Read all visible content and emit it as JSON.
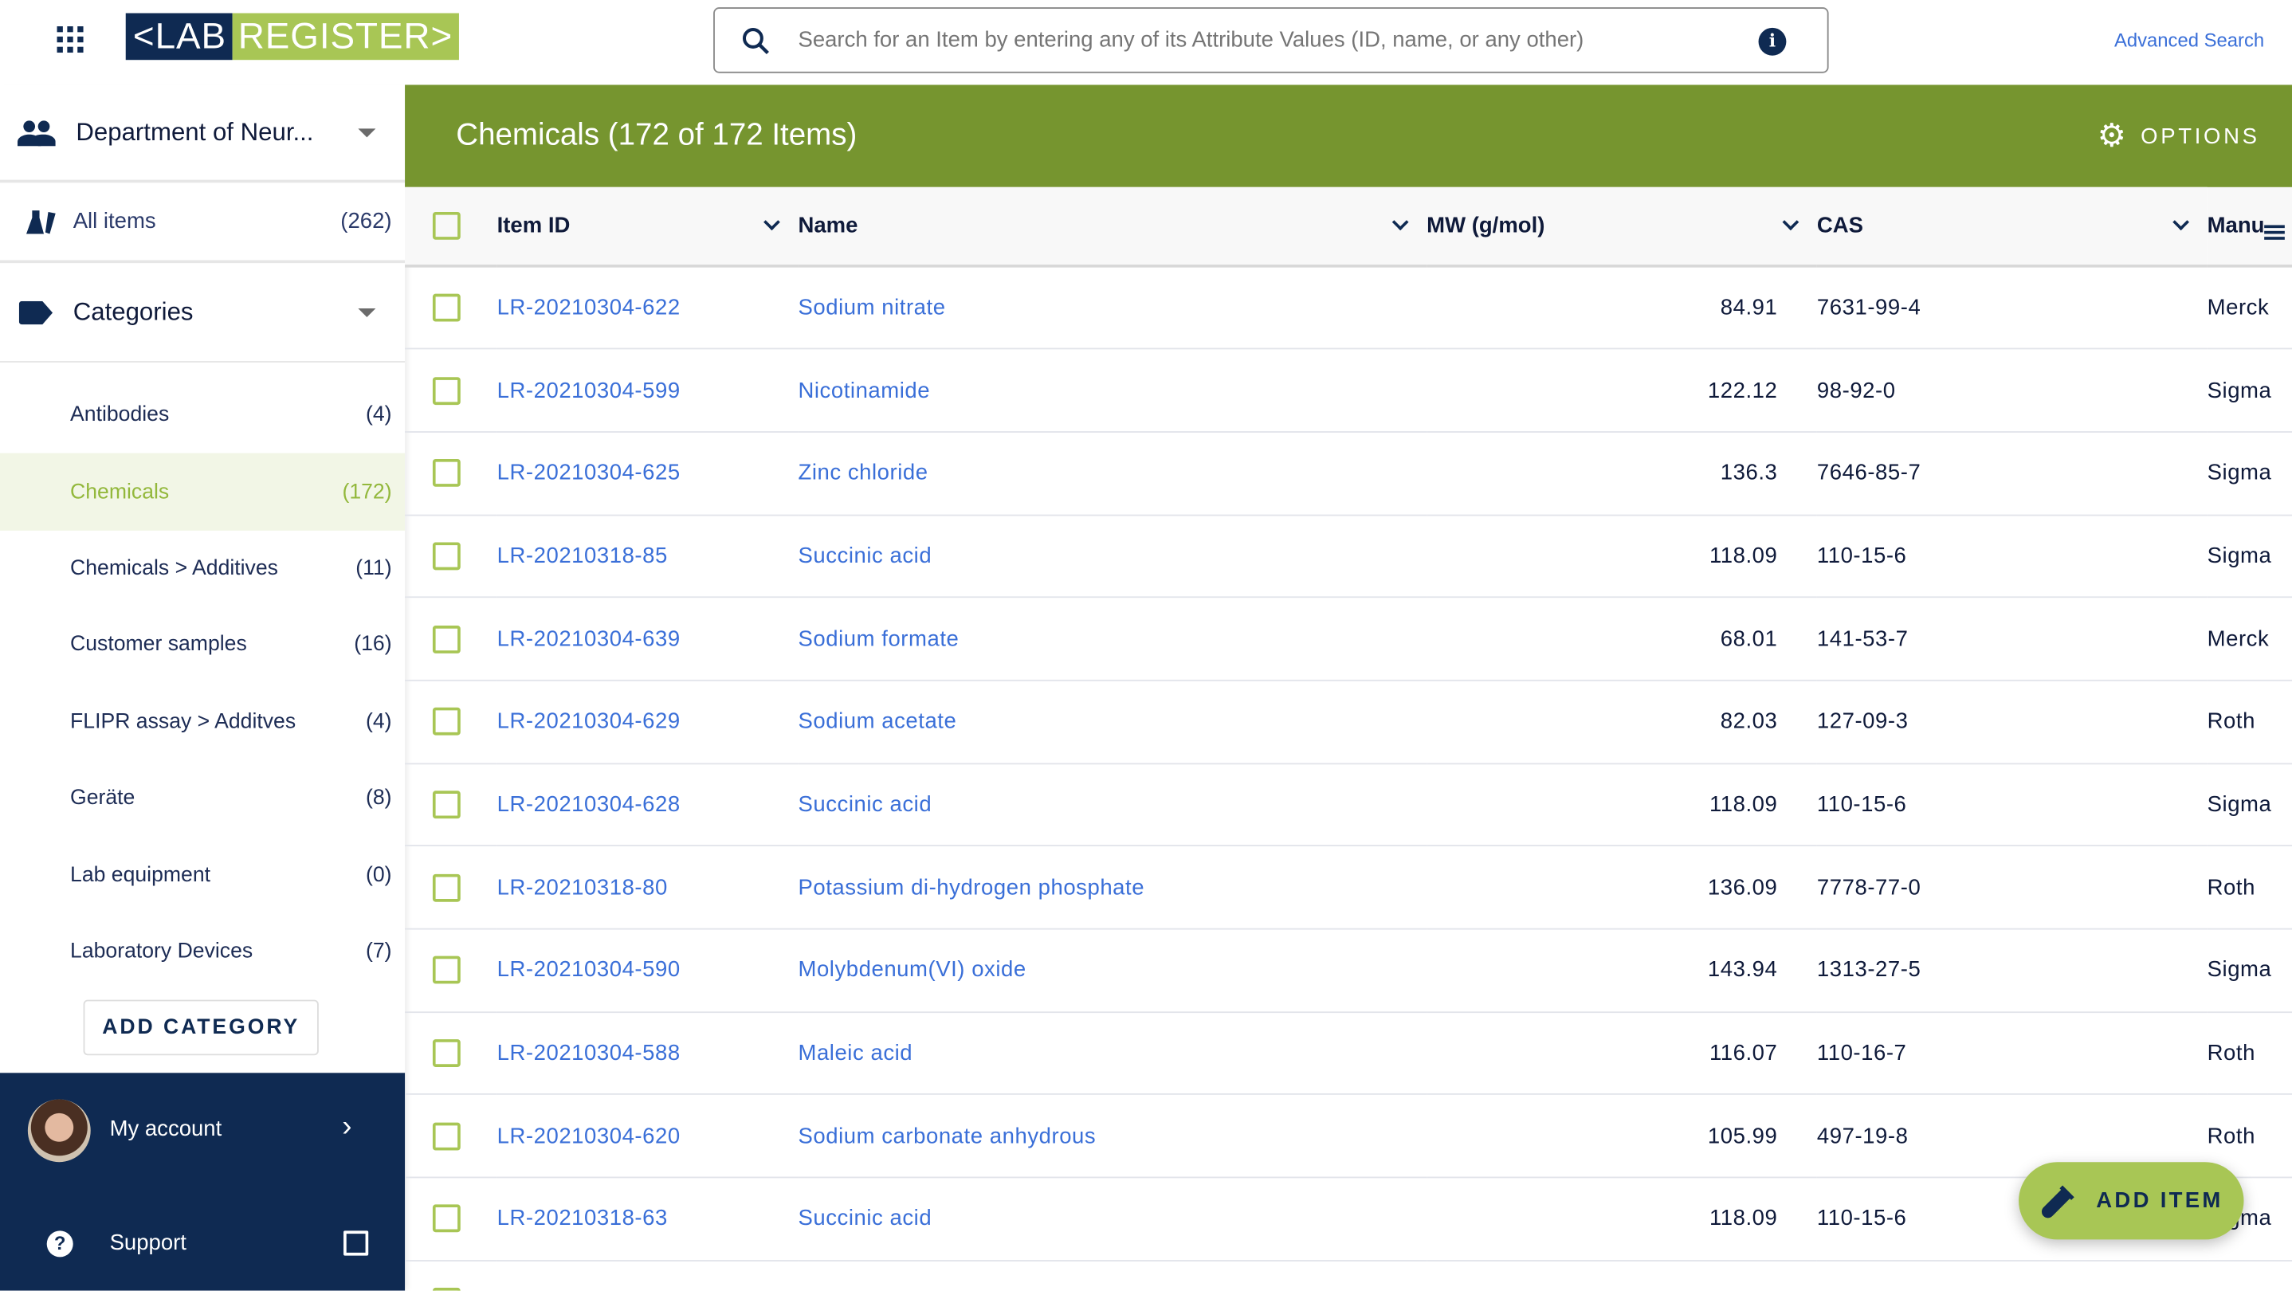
{
  "header": {
    "logo_left": "<LAB",
    "logo_right": "REGISTER>",
    "search_placeholder": "Search for an Item by entering any of its Attribute Values (ID, name, or any other)",
    "advanced_search": "Advanced Search"
  },
  "sidebar": {
    "department": "Department of Neur...",
    "all_items": {
      "label": "All items",
      "count": "(262)"
    },
    "categories_label": "Categories",
    "categories": [
      {
        "label": "Antibodies",
        "count": "(4)"
      },
      {
        "label": "Chemicals",
        "count": "(172)"
      },
      {
        "label": "Chemicals > Additives",
        "count": "(11)"
      },
      {
        "label": "Customer samples",
        "count": "(16)"
      },
      {
        "label": "FLIPR assay > Additves",
        "count": "(4)"
      },
      {
        "label": "Geräte",
        "count": "(8)"
      },
      {
        "label": "Lab equipment",
        "count": "(0)"
      },
      {
        "label": "Laboratory Devices",
        "count": "(7)"
      }
    ],
    "add_category": "ADD CATEGORY",
    "my_account": "My account",
    "support": "Support"
  },
  "main": {
    "title": "Chemicals (172 of 172 Items)",
    "options": "OPTIONS",
    "add_item": "ADD ITEM",
    "columns": [
      "Item ID",
      "Name",
      "MW (g/mol)",
      "CAS",
      "Manu"
    ],
    "rows": [
      [
        "LR-20210304-622",
        "Sodium nitrate",
        "84.91",
        "7631-99-4",
        "Merck"
      ],
      [
        "LR-20210304-599",
        "Nicotinamide",
        "122.12",
        "98-92-0",
        "Sigma"
      ],
      [
        "LR-20210304-625",
        "Zinc chloride",
        "136.3",
        "7646-85-7",
        "Sigma"
      ],
      [
        "LR-20210318-85",
        "Succinic acid",
        "118.09",
        "110-15-6",
        "Sigma"
      ],
      [
        "LR-20210304-639",
        "Sodium formate",
        "68.01",
        "141-53-7",
        "Merck"
      ],
      [
        "LR-20210304-629",
        "Sodium acetate",
        "82.03",
        "127-09-3",
        "Roth"
      ],
      [
        "LR-20210304-628",
        "Succinic acid",
        "118.09",
        "110-15-6",
        "Sigma"
      ],
      [
        "LR-20210318-80",
        "Potassium di-hydrogen phosphate",
        "136.09",
        "7778-77-0",
        "Roth"
      ],
      [
        "LR-20210304-590",
        "Molybdenum(VI) oxide",
        "143.94",
        "1313-27-5",
        "Sigma"
      ],
      [
        "LR-20210304-588",
        "Maleic acid",
        "116.07",
        "110-16-7",
        "Roth"
      ],
      [
        "LR-20210304-620",
        "Sodium carbonate anhydrous",
        "105.99",
        "497-19-8",
        "Roth"
      ],
      [
        "LR-20210318-63",
        "Succinic acid",
        "118.09",
        "110-15-6",
        "Sigma"
      ]
    ]
  }
}
